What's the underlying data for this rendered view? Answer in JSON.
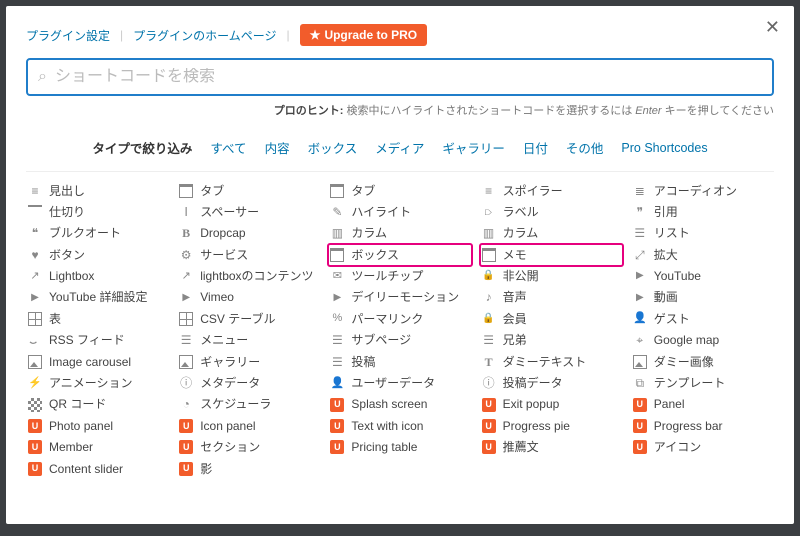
{
  "header": {
    "plugin_settings": "プラグイン設定",
    "plugin_homepage": "プラグインのホームページ",
    "upgrade": "Upgrade to PRO"
  },
  "search": {
    "placeholder": "ショートコードを検索"
  },
  "hint": {
    "prefix": "プロのヒント:",
    "body": "検索中にハイライトされたショートコードを選択するには",
    "key": "Enter",
    "suffix": "キーを押してください"
  },
  "filters": {
    "label": "タイプで絞り込み",
    "items": [
      "すべて",
      "内容",
      "ボックス",
      "メディア",
      "ギャラリー",
      "日付",
      "その他",
      "Pro Shortcodes"
    ]
  },
  "cols": [
    [
      {
        "l": "見出し",
        "ic": "i-lines",
        "n": "heading"
      },
      {
        "l": "仕切り",
        "ic": "i-hr",
        "n": "divider"
      },
      {
        "l": "ブルクオート",
        "ic": "i-quote",
        "n": "pullquote"
      },
      {
        "l": "ボタン",
        "ic": "i-heart",
        "n": "button"
      },
      {
        "l": "Lightbox",
        "ic": "i-ext",
        "n": "lightbox"
      },
      {
        "l": "YouTube 詳細設定",
        "ic": "i-yt",
        "n": "youtube-advanced"
      },
      {
        "l": "表",
        "ic": "i-table",
        "n": "table"
      },
      {
        "l": "RSS フィード",
        "ic": "i-rss",
        "n": "rss-feed"
      },
      {
        "l": "Image carousel",
        "ic": "i-img",
        "n": "image-carousel"
      },
      {
        "l": "アニメーション",
        "ic": "i-bolt",
        "n": "animation"
      },
      {
        "l": "QR コード",
        "ic": "i-qr",
        "n": "qr-code"
      },
      {
        "l": "Photo panel",
        "pro": true,
        "n": "photo-panel"
      },
      {
        "l": "Member",
        "pro": true,
        "n": "member"
      },
      {
        "l": "Content slider",
        "pro": true,
        "n": "content-slider"
      }
    ],
    [
      {
        "l": "タブ",
        "ic": "i-win",
        "n": "tabs"
      },
      {
        "l": "スペーサー",
        "ic": "i-sp",
        "n": "spacer"
      },
      {
        "l": "Dropcap",
        "ic": "i-dc",
        "n": "dropcap"
      },
      {
        "l": "サービス",
        "ic": "i-gear",
        "n": "service"
      },
      {
        "l": "lightboxのコンテンツ",
        "ic": "i-ext",
        "n": "lightbox-content"
      },
      {
        "l": "Vimeo",
        "ic": "i-yt",
        "n": "vimeo"
      },
      {
        "l": "CSV テーブル",
        "ic": "i-table",
        "n": "csv-table"
      },
      {
        "l": "メニュー",
        "ic": "i-list",
        "n": "menu"
      },
      {
        "l": "ギャラリー",
        "ic": "i-img",
        "n": "gallery"
      },
      {
        "l": "メタデータ",
        "ic": "i-info",
        "n": "meta-data"
      },
      {
        "l": "スケジューラ",
        "ic": "i-clock",
        "n": "scheduler"
      },
      {
        "l": "Icon panel",
        "pro": true,
        "n": "icon-panel"
      },
      {
        "l": "セクション",
        "pro": true,
        "n": "section"
      },
      {
        "l": "影",
        "pro": true,
        "n": "shadow"
      }
    ],
    [
      {
        "l": "タブ",
        "ic": "i-win",
        "n": "tab"
      },
      {
        "l": "ハイライト",
        "ic": "i-pen",
        "n": "highlight"
      },
      {
        "l": "カラム",
        "ic": "i-col",
        "n": "columns"
      },
      {
        "l": "ボックス",
        "ic": "i-win",
        "n": "box",
        "hl": true
      },
      {
        "l": "ツールチップ",
        "ic": "i-chat",
        "n": "tooltip"
      },
      {
        "l": "デイリーモーション",
        "ic": "i-yt",
        "n": "dailymotion"
      },
      {
        "l": "パーマリンク",
        "ic": "i-link",
        "n": "permalink"
      },
      {
        "l": "サブページ",
        "ic": "i-list",
        "n": "subpages"
      },
      {
        "l": "投稿",
        "ic": "i-list",
        "n": "posts"
      },
      {
        "l": "ユーザーデータ",
        "ic": "i-user",
        "n": "user-data"
      },
      {
        "l": "Splash screen",
        "pro": true,
        "n": "splash-screen"
      },
      {
        "l": "Text with icon",
        "pro": true,
        "n": "text-with-icon"
      },
      {
        "l": "Pricing table",
        "pro": true,
        "n": "pricing-table"
      }
    ],
    [
      {
        "l": "スポイラー",
        "ic": "i-lines",
        "n": "spoiler"
      },
      {
        "l": "ラベル",
        "ic": "i-tag",
        "n": "label"
      },
      {
        "l": "カラム",
        "ic": "i-col",
        "n": "column"
      },
      {
        "l": "メモ",
        "ic": "i-win",
        "n": "note",
        "hl": true
      },
      {
        "l": "非公開",
        "ic": "i-lock",
        "n": "private"
      },
      {
        "l": "音声",
        "ic": "i-snd",
        "n": "audio"
      },
      {
        "l": "会員",
        "ic": "i-lock",
        "n": "members"
      },
      {
        "l": "兄弟",
        "ic": "i-list",
        "n": "siblings"
      },
      {
        "l": "ダミーテキスト",
        "ic": "i-txt",
        "n": "dummy-text"
      },
      {
        "l": "投稿データ",
        "ic": "i-info",
        "n": "post-data"
      },
      {
        "l": "Exit popup",
        "pro": true,
        "n": "exit-popup"
      },
      {
        "l": "Progress pie",
        "pro": true,
        "n": "progress-pie"
      },
      {
        "l": "推薦文",
        "pro": true,
        "n": "testimonial"
      }
    ],
    [
      {
        "l": "アコーディオン",
        "ic": "i-acc",
        "n": "accordion"
      },
      {
        "l": "引用",
        "ic": "i-qq",
        "n": "quote"
      },
      {
        "l": "リスト",
        "ic": "i-list",
        "n": "list"
      },
      {
        "l": "拡大",
        "ic": "i-expand",
        "n": "expand"
      },
      {
        "l": "YouTube",
        "ic": "i-yt",
        "n": "youtube"
      },
      {
        "l": "動画",
        "ic": "i-play",
        "n": "video"
      },
      {
        "l": "ゲスト",
        "ic": "i-user",
        "n": "guests"
      },
      {
        "l": "Google map",
        "ic": "i-map",
        "n": "google-map"
      },
      {
        "l": "ダミー画像",
        "ic": "i-img",
        "n": "dummy-image"
      },
      {
        "l": "テンプレート",
        "ic": "i-tmpl",
        "n": "template"
      },
      {
        "l": "Panel",
        "pro": true,
        "n": "panel"
      },
      {
        "l": "Progress bar",
        "pro": true,
        "n": "progress-bar"
      },
      {
        "l": "アイコン",
        "pro": true,
        "n": "icon"
      }
    ]
  ]
}
